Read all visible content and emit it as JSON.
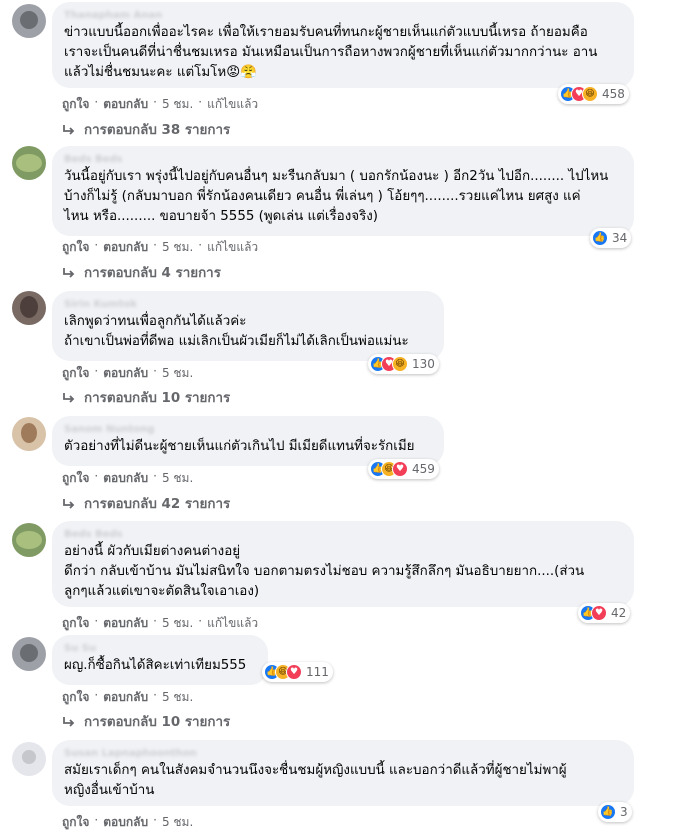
{
  "comments": [
    {
      "author": "Thanapham Anan",
      "text": "ข่าวแบบนี้ออกเพื่ออะไรคะ เพื่อให้เรายอมรับคนที่ทนกะผู้ชายเห็นแก่ตัวแบบนี้เหรอ ถ้ายอมคือ\nเราจะเป็นคนดีที่น่าชื่นชมเหรอ มันเหมือนเป็นการถือหางพวกผู้ชายที่เห็นแก่ตัวมากกว่านะ อาน\nแล้วไม่ชื่นชมนะคะ แต่โมโห😡😤",
      "reactions": [
        "like",
        "love",
        "haha"
      ],
      "reaction_count": "458",
      "actions": [
        "ถูกใจ",
        "ตอบกลับ",
        "5 ชม.",
        "แก้ไขแล้ว"
      ],
      "replies": "การตอบกลับ 38 รายการ"
    },
    {
      "author": "Beds Beds",
      "text": "วันนี้อยู่กับเรา พรุ่งนี้ไปอยู่กับคนอื่นๆ มะรืนกลับมา ( บอกรักน้องนะ ) อีก2วัน ไปอีก........ ไปไหน\nบ้างก็ไม่รู้ (กลับมาบอก พี่รักน้องคนเดียว คนอื่น พี่เล่นๆ ) โอ้ยๆๆ........รวยแค่ไหน ยศสูง แค่\nไหน หรือ......... ขอบายจ้า 5555 (พูดเล่น แต่เรื่องจริง)",
      "reactions": [
        "like"
      ],
      "reaction_count": "34",
      "actions": [
        "ถูกใจ",
        "ตอบกลับ",
        "5 ชม.",
        "แก้ไขแล้ว"
      ],
      "replies": "การตอบกลับ 4 รายการ"
    },
    {
      "author": "Sirin Kumtok",
      "text": "เลิกพูดว่าทนเพื่อลูกกันได้แล้วค่ะ\nถ้าเขาเป็นพ่อที่ดีพอ แม่เลิกเป็นผัวเมียก็ไม่ได้เลิกเป็นพ่อแม่นะ",
      "reactions": [
        "like",
        "love",
        "haha"
      ],
      "reaction_count": "130",
      "actions": [
        "ถูกใจ",
        "ตอบกลับ",
        "5 ชม."
      ],
      "replies": "การตอบกลับ 10 รายการ"
    },
    {
      "author": "Sanom Nuntong",
      "text": "ตัวอย่างที่ไม่ดีนะผู้ชายเห็นแก่ตัวเกินไป มีเมียดีแทนที่จะรักเมีย",
      "reactions": [
        "like",
        "haha",
        "love"
      ],
      "reaction_count": "459",
      "actions": [
        "ถูกใจ",
        "ตอบกลับ",
        "5 ชม."
      ],
      "replies": "การตอบกลับ 42 รายการ"
    },
    {
      "author": "Beds Beds",
      "text": "อย่างนี้ ผัวกับเมียต่างคนต่างอยู่\nดีกว่า กลับเข้าบ้าน มันไม่สนิทใจ บอกตามตรงไม่ชอบ ความรู้สึกลึกๆ มันอธิบายยาก....(ส่วน\nลูกๆแล้วแต่เขาจะตัดสินใจเอาเอง)",
      "reactions": [
        "like",
        "love"
      ],
      "reaction_count": "42",
      "actions": [
        "ถูกใจ",
        "ตอบกลับ",
        "5 ชม.",
        "แก้ไขแล้ว"
      ],
      "replies": ""
    },
    {
      "author": "Su Su",
      "text": "ผญ.ก็ซื้อกินได้สิคะเท่าเทียม555",
      "reactions": [
        "like",
        "haha",
        "love"
      ],
      "reaction_count": "111",
      "actions": [
        "ถูกใจ",
        "ตอบกลับ",
        "5 ชม."
      ],
      "replies": "การตอบกลับ 10 รายการ"
    },
    {
      "author": "Susan Lapnaphoonthon",
      "text": "สมัยเราเด็กๆ คนในสังคมจำนวนนึงจะชื่นชมผู้หญิงแบบนี้ และบอกว่าดีแล้วที่ผู้ชายไม่พาผู้\nหญิงอื่นเข้าบ้าน",
      "reactions": [
        "like"
      ],
      "reaction_count": "3",
      "actions": [
        "ถูกใจ",
        "ตอบกลับ",
        "5 ชม."
      ],
      "replies": ""
    }
  ],
  "icons": {
    "reply_arrow": "reply-arrow-icon",
    "like": "like-icon",
    "love": "love-icon",
    "haha": "haha-icon"
  },
  "colors": {
    "bubble": "#f0f2f5",
    "secondary_text": "#65676b",
    "like": "#1877f2",
    "love": "#f33e58",
    "haha": "#f7b125"
  }
}
